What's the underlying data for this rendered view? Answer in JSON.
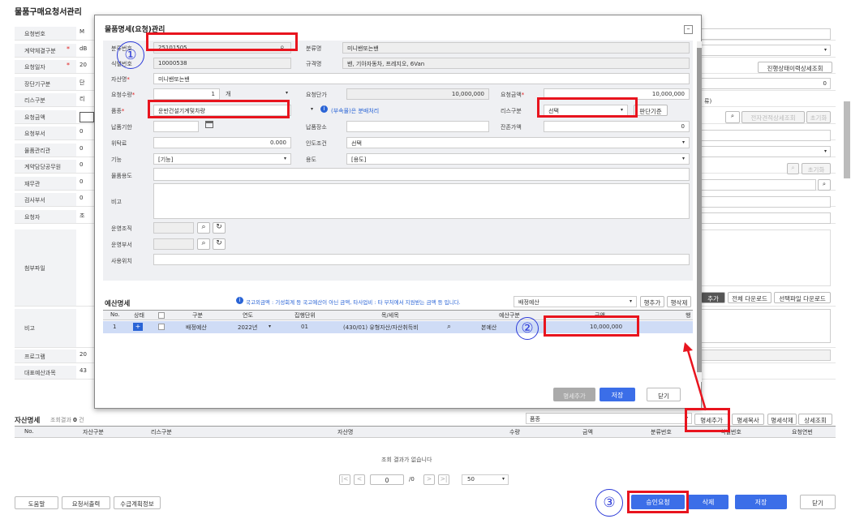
{
  "page": {
    "title": "물품구매요청서관리"
  },
  "background_form": {
    "rows": [
      {
        "label": "요청번호",
        "value": "M",
        "req": false
      },
      {
        "label": "계약체결구분",
        "value": "dB",
        "req": true
      },
      {
        "label": "요청일자",
        "value": "20",
        "req": true
      },
      {
        "label": "장단기구분",
        "value": "단",
        "req": false
      },
      {
        "label": "리스구분",
        "value": "리",
        "req": false
      },
      {
        "label": "요청금액",
        "value": "",
        "req": false
      },
      {
        "label": "요청부서",
        "value": "0",
        "req": false
      },
      {
        "label": "물품관리관",
        "value": "0",
        "req": false
      },
      {
        "label": "계약담당공무원",
        "value": "0",
        "req": false
      },
      {
        "label": "재무관",
        "value": "0",
        "req": false
      },
      {
        "label": "검사부서",
        "value": "0",
        "req": false
      },
      {
        "label": "요청자",
        "value": "조",
        "req": false
      }
    ],
    "attachment_label": "첨부파일",
    "remarks_label": "비고",
    "program_label": "프로그램",
    "program_value": "20",
    "budget_label": "대표예산과목",
    "budget_value": "43",
    "progress_button": "진행상태이력상세조회",
    "zero_value": "0",
    "right_btn1": "전자견적상세조회",
    "right_btn2": "초기화",
    "right_btn3": "초기화",
    "add_attach": "추가",
    "download_all": "전체 다운로드",
    "download_selected": "선택파일 다운로드",
    "right_paren": "류)"
  },
  "modal": {
    "title": "물품명세(요청)관리",
    "fields": {
      "class_no_label": "분류번호",
      "class_no": "25101505",
      "class_name_label": "분류명",
      "class_name": "미니밴또는밴",
      "item_no_label": "식별번호",
      "item_no": "10000538",
      "spec_label": "규격명",
      "spec": "밴, 기아자동차, 프레지오, 6Van",
      "asset_name_label": "자산명",
      "asset_name": "미니밴또는밴",
      "qty_label": "요청수량",
      "qty": "1",
      "unit": "개",
      "unit_price_label": "요청단가",
      "unit_price": "10,000,000",
      "amount_label": "요청금액",
      "amount": "10,000,000",
      "category_label": "품종",
      "category": "운반건설기계및차량",
      "note_link": "(부속물)은 분배처리",
      "lease_label": "리스구분",
      "lease": "선택",
      "judge_btn": "판단기준",
      "delivery_label": "납품기한",
      "place_label": "납품장소",
      "residual_label": "잔존가액",
      "residual": "0",
      "fee_label": "위탁료",
      "fee": "0.000",
      "terms_label": "인도조건",
      "terms": "선택",
      "func_label": "기능",
      "func": "[기능]",
      "use_label": "용도",
      "use": "[용도]",
      "purpose_label": "물품용도",
      "remark_label": "비고",
      "org_label": "운영조직",
      "dept_label": "운영부서",
      "location_label": "사용위치"
    },
    "budget": {
      "section_title": "예산명세",
      "notice": "국고외금액 : 기성회계 등 국고예산이 아닌 금액, 타사업비 : 타 부처에서 지원받는 금액 등 입니다.",
      "type_select": "배정예산",
      "add_row": "행추가",
      "del_row": "행삭제",
      "columns": [
        "No.",
        "상태",
        "",
        "구분",
        "연도",
        "집행단위",
        "목/세목",
        "",
        "예산구분",
        "금액",
        "행"
      ],
      "rows": [
        {
          "no": "1",
          "type": "배정예산",
          "year": "2022년",
          "unit": "01",
          "item": "(430/01) 유형자산/자산취득비",
          "budget_type": "본예산",
          "amount": "10,000,000"
        }
      ]
    },
    "footer": {
      "button_disabled": "명세추가",
      "save": "저장",
      "close": "닫기"
    }
  },
  "asset_list": {
    "title": "자산명세",
    "result_label": "조회결과",
    "count": "0",
    "count_unit": "건",
    "category_select": "품종",
    "buttons": [
      "명세추가",
      "명세복사",
      "명세삭제",
      "상세조회"
    ],
    "columns": [
      "No.",
      "자산구분",
      "리스구분",
      "자산명",
      "수량",
      "금액",
      "분류번호",
      "식별번호",
      "요청연번"
    ],
    "empty": "조회 결과가 없습니다",
    "pager": {
      "page": "0",
      "total": "/0",
      "size": "50"
    }
  },
  "bottom": {
    "left_buttons": [
      "도움말",
      "요청서출력",
      "수급계획정보"
    ],
    "approve": "승인요청",
    "delete": "삭제",
    "save": "저장",
    "close": "닫기"
  },
  "annotations": {
    "one": "①",
    "two": "②",
    "three": "③"
  },
  "colors": {
    "accent": "#3b6ee8",
    "highlight": "#e8141e",
    "annotation": "#2d3bd8"
  }
}
